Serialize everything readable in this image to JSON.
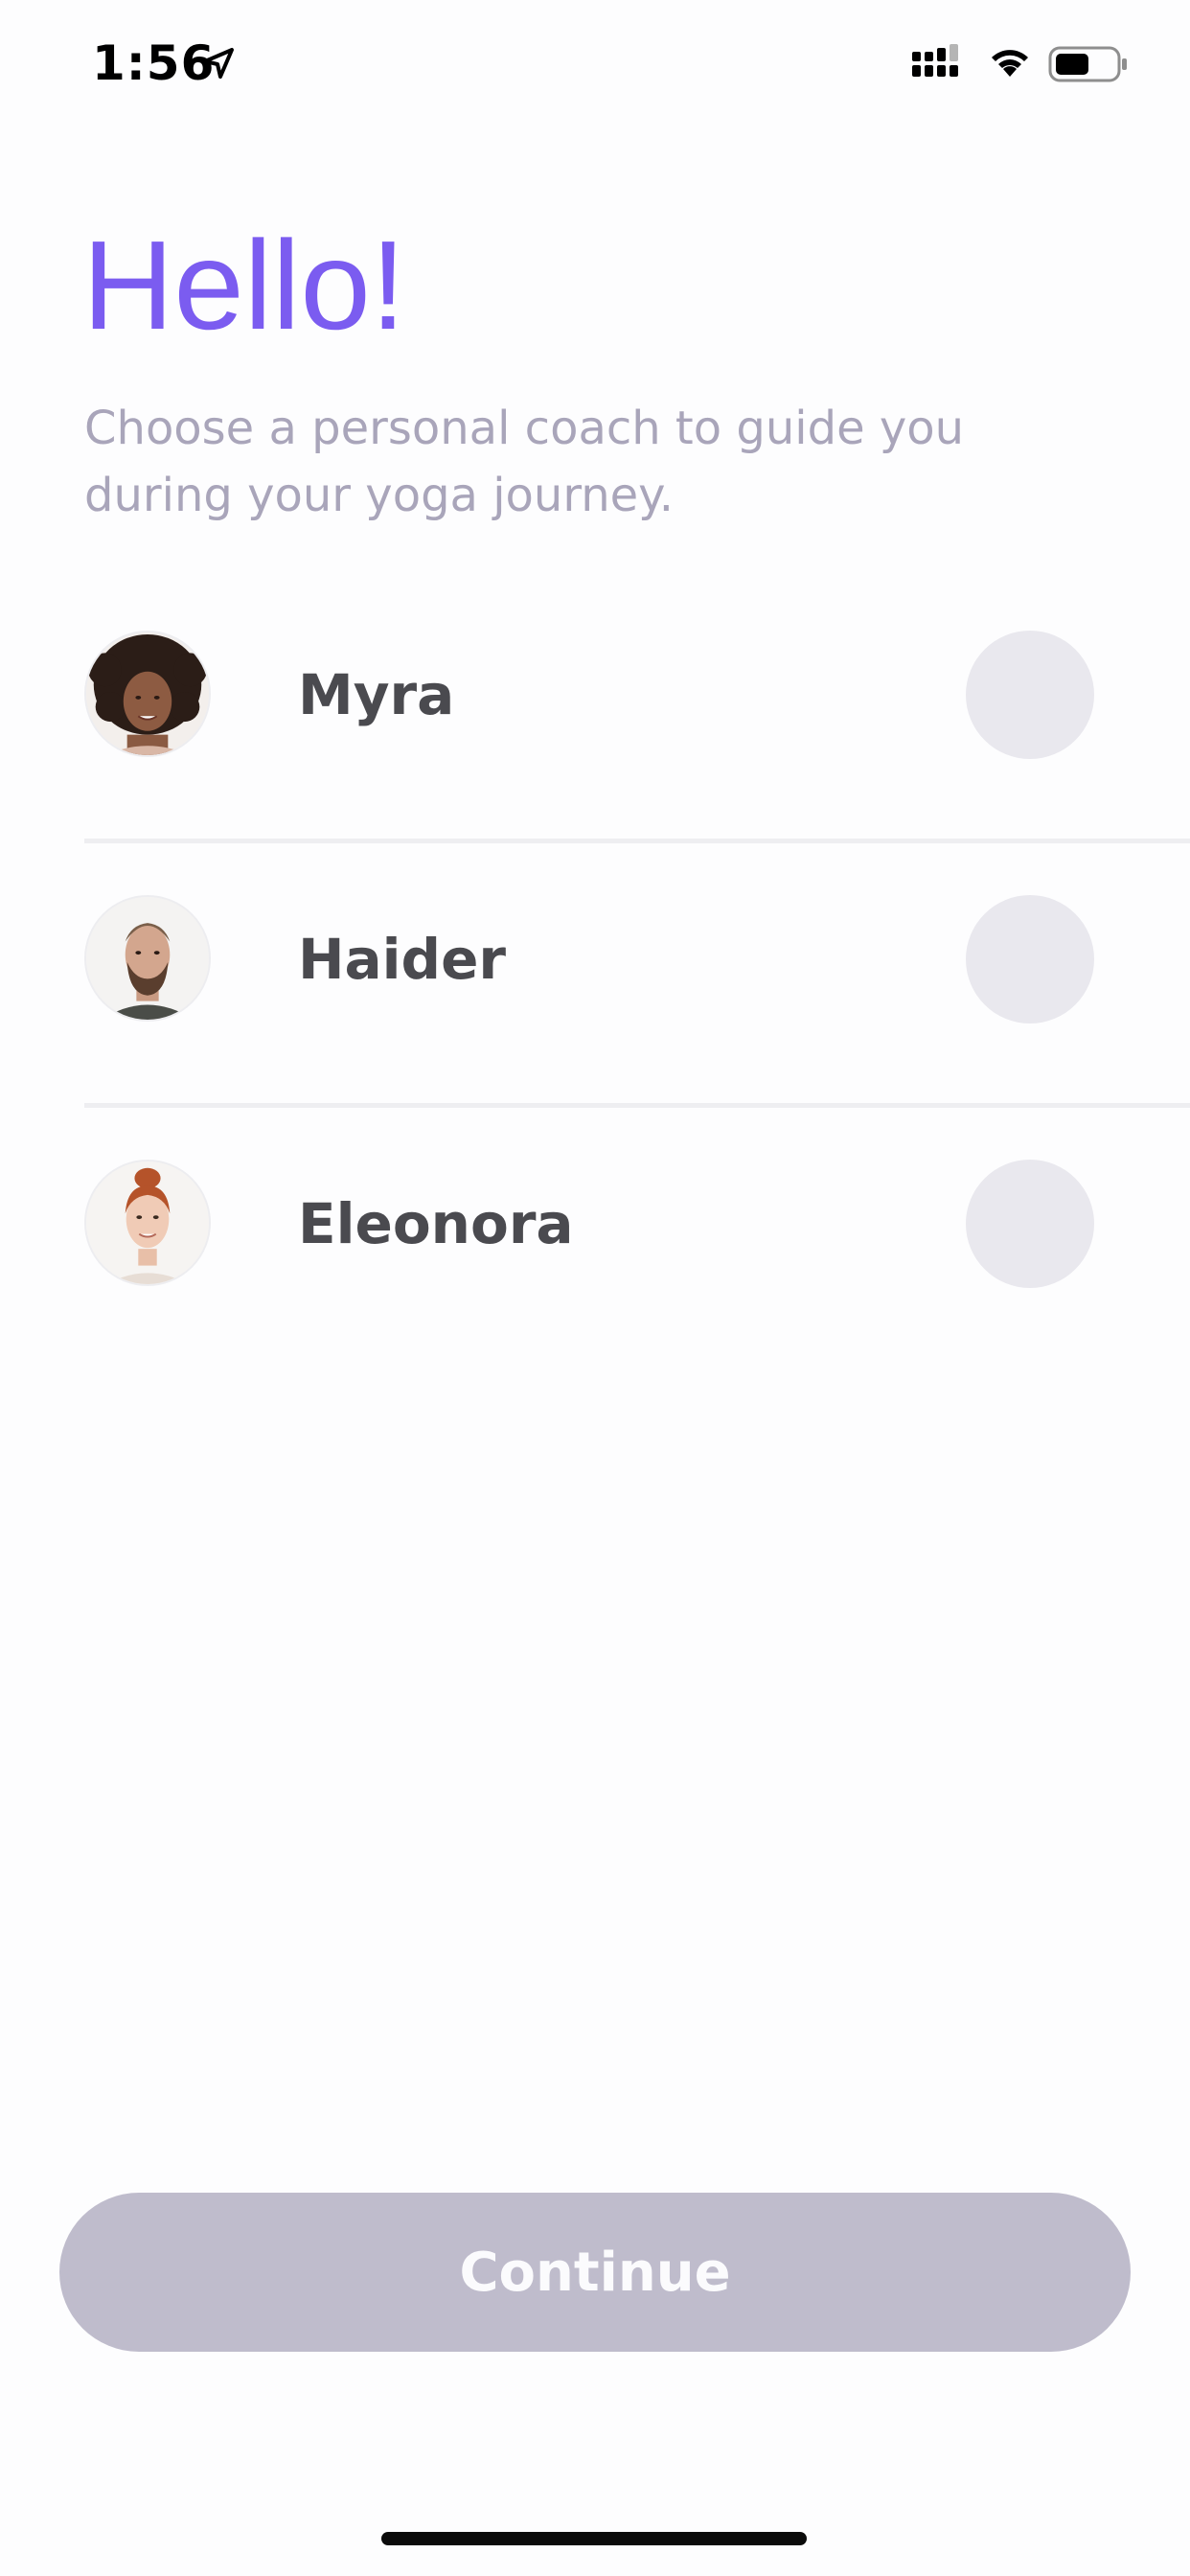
{
  "status_bar": {
    "time": "1:56",
    "icons": [
      "location-arrow-icon",
      "cellular-signal-icon",
      "wifi-icon",
      "battery-icon"
    ]
  },
  "header": {
    "title": "Hello!",
    "subtitle": "Choose a personal coach to guide you during your yoga journey."
  },
  "coaches": [
    {
      "name": "Myra",
      "selected": false
    },
    {
      "name": "Haider",
      "selected": false
    },
    {
      "name": "Eleonora",
      "selected": false
    }
  ],
  "continue_button": {
    "label": "Continue",
    "enabled": false
  },
  "colors": {
    "accent": "#7b5cf0",
    "subtitle": "#a9a5ba",
    "name_text": "#4a4a4f",
    "radio_fill": "#e9e8ee",
    "button_disabled": "#bfbccc"
  }
}
